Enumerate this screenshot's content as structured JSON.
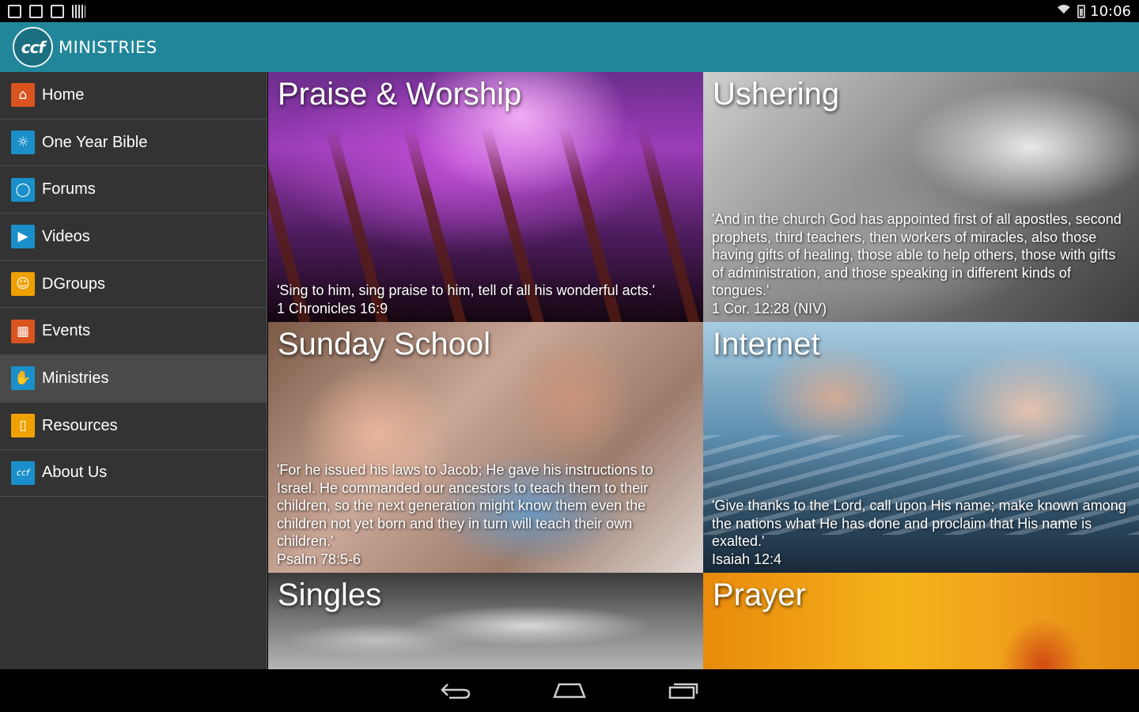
{
  "status_bar": {
    "time": "10:06",
    "icons": [
      "sim-icon",
      "briefcase-icon",
      "briefcase-icon",
      "barcode-icon",
      "wifi-icon",
      "battery-icon"
    ]
  },
  "action_bar": {
    "logo_text": "ccf",
    "title": "MINISTRIES"
  },
  "sidebar": {
    "items": [
      {
        "label": "Home",
        "icon": "home-icon",
        "color": "#d9541e",
        "glyph": "⌂"
      },
      {
        "label": "One Year Bible",
        "icon": "sun-icon",
        "color": "#1b8fc9",
        "glyph": "☼"
      },
      {
        "label": "Forums",
        "icon": "chat-bubble-icon",
        "color": "#1b8fc9",
        "glyph": "◯"
      },
      {
        "label": "Videos",
        "icon": "video-camera-icon",
        "color": "#1b8fc9",
        "glyph": "▶"
      },
      {
        "label": "DGroups",
        "icon": "group-icon",
        "color": "#f0a000",
        "glyph": "☺"
      },
      {
        "label": "Events",
        "icon": "calendar-icon",
        "color": "#d9541e",
        "glyph": "▦"
      },
      {
        "label": "Ministries",
        "icon": "hand-icon",
        "color": "#1b8fc9",
        "glyph": "✋"
      },
      {
        "label": "Resources",
        "icon": "book-icon",
        "color": "#f0a000",
        "glyph": "▯"
      },
      {
        "label": "About Us",
        "icon": "ccf-logo-icon",
        "color": "#1b8fc9",
        "glyph": "ccf"
      }
    ],
    "active_index": 6
  },
  "tiles": [
    {
      "title": "Praise & Worship",
      "quote": "'Sing to him, sing praise to him, tell of all his wonderful acts.'",
      "ref": "1 Chronicles 16:9"
    },
    {
      "title": "Ushering",
      "quote": "'And in the church God has appointed first of all apostles, second prophets, third teachers, then workers of miracles, also those having gifts of healing, those able to help others, those with gifts of administration, and those speaking in different kinds of tongues.'",
      "ref": "1 Cor. 12:28 (NIV)"
    },
    {
      "title": "Sunday School",
      "quote": "'For he issued his laws to Jacob; He gave his instructions to Israel. He commanded our ancestors to teach them to their children, so the next generation might know them  even the children not yet born and they in turn will teach their own children.'",
      "ref": "Psalm 78:5-6"
    },
    {
      "title": "Internet",
      "quote": "'Give thanks to the Lord, call upon His name; make known among the nations what He has done and proclaim that His name is exalted.'",
      "ref": "Isaiah 12:4"
    },
    {
      "title": "Singles",
      "quote": "",
      "ref": ""
    },
    {
      "title": "Prayer",
      "quote": "",
      "ref": ""
    }
  ],
  "system_nav": {
    "buttons": [
      "back-icon",
      "home-icon",
      "recent-apps-icon"
    ]
  }
}
